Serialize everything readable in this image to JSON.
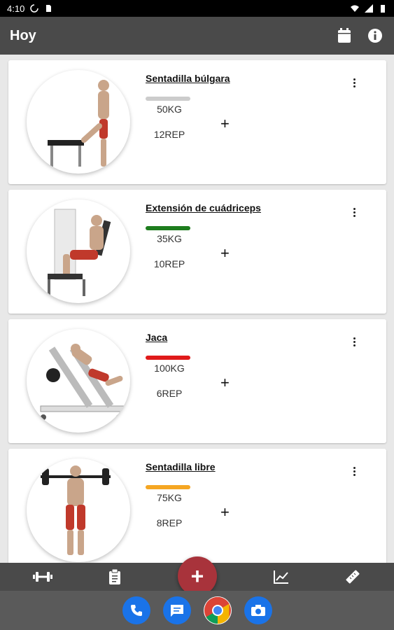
{
  "status": {
    "time": "4:10"
  },
  "appbar": {
    "title": "Hoy"
  },
  "exercises": [
    {
      "name": "Sentadilla búlgara",
      "weight": "50KG",
      "reps": "12REP",
      "bar_color": "#cccccc"
    },
    {
      "name": "Extensión de cuádriceps",
      "weight": "35KG",
      "reps": "10REP",
      "bar_color": "#1e7d1e"
    },
    {
      "name": "Jaca",
      "weight": "100KG",
      "reps": "6REP",
      "bar_color": "#e01a1a"
    },
    {
      "name": "Sentadilla libre",
      "weight": "75KG",
      "reps": "8REP",
      "bar_color": "#f5a623"
    }
  ],
  "add_symbol": "+",
  "fab_symbol": "+",
  "nav": [
    "dumbbell-icon",
    "clipboard-icon",
    "chart-icon",
    "ruler-icon"
  ],
  "dock": [
    "phone-app",
    "messages-app",
    "chrome-app",
    "camera-app"
  ]
}
